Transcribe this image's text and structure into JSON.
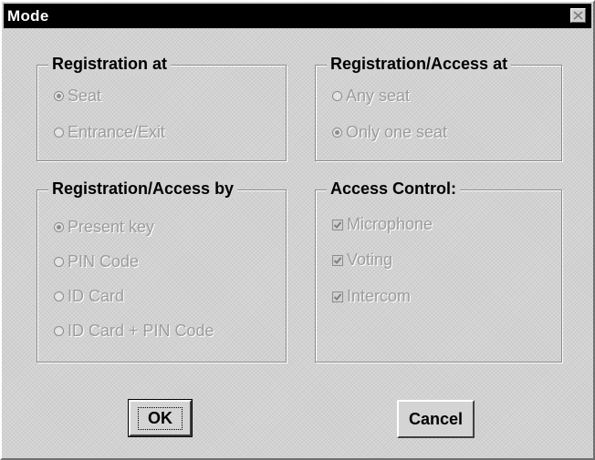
{
  "window": {
    "title": "Mode"
  },
  "groups": {
    "registration_at": {
      "label": "Registration at",
      "options": [
        {
          "label": "Seat",
          "checked": true
        },
        {
          "label": "Entrance/Exit",
          "checked": false
        }
      ]
    },
    "registration_access_at": {
      "label": "Registration/Access at",
      "options": [
        {
          "label": "Any seat",
          "checked": false
        },
        {
          "label": "Only one seat",
          "checked": true
        }
      ]
    },
    "registration_access_by": {
      "label": "Registration/Access by",
      "options": [
        {
          "label": "Present key",
          "checked": true
        },
        {
          "label": "PIN Code",
          "checked": false
        },
        {
          "label": "ID Card",
          "checked": false
        },
        {
          "label": "ID Card + PIN Code",
          "checked": false
        }
      ]
    },
    "access_control": {
      "label": "Access Control:",
      "options": [
        {
          "label": "Microphone",
          "checked": true
        },
        {
          "label": "Voting",
          "checked": true
        },
        {
          "label": "Intercom",
          "checked": true
        }
      ]
    }
  },
  "buttons": {
    "ok": "OK",
    "cancel": "Cancel"
  },
  "colors": {
    "titlebar": "#000000",
    "dialog_bg": "#d2d2d2",
    "disabled_text": "#9c9c9c"
  }
}
